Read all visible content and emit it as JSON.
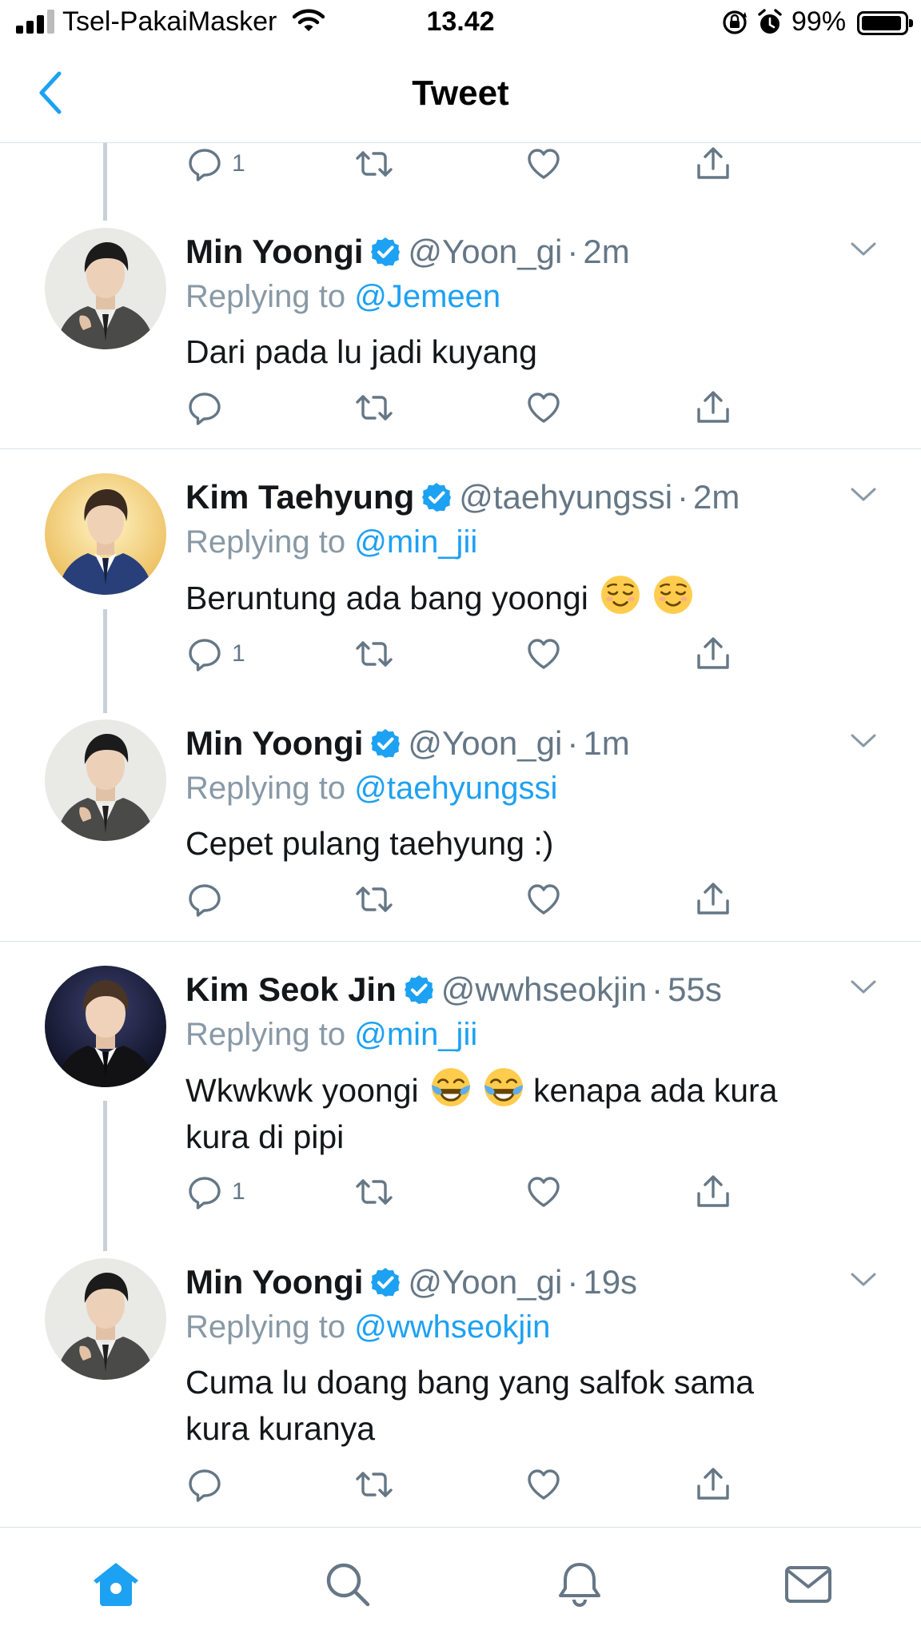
{
  "status_bar": {
    "carrier": "Tsel-PakaiMasker",
    "time": "13.42",
    "battery": "99%",
    "battery_level": 0.99
  },
  "nav": {
    "title": "Tweet",
    "back_icon": "chevron-left-icon"
  },
  "top_actions": {
    "reply_count": "1"
  },
  "tweets": [
    {
      "name": "Min Yoongi",
      "verified": true,
      "handle": "@Yoon_gi",
      "dot": "·",
      "time": "2m",
      "replying_label": "Replying to",
      "replying_to": "@Jemeen",
      "text": "Dari pada lu jadi kuyang",
      "reply_count": ""
    },
    {
      "name": "Kim Taehyung",
      "verified": true,
      "handle": "@taehyungssi",
      "dot": "·",
      "time": "2m",
      "replying_label": "Replying to",
      "replying_to": "@min_jii",
      "text": "Beruntung ada bang yoongi",
      "emojis": [
        "relieved-face-emoji",
        "relieved-face-emoji"
      ],
      "reply_count": "1"
    },
    {
      "name": "Min Yoongi",
      "verified": true,
      "handle": "@Yoon_gi",
      "dot": "·",
      "time": "1m",
      "replying_label": "Replying to",
      "replying_to": "@taehyungssi",
      "text": "Cepet pulang taehyung :)",
      "reply_count": ""
    },
    {
      "name": "Kim Seok Jin",
      "verified": true,
      "handle": "@wwhseokjin",
      "dot": "·",
      "time": "55s",
      "replying_label": "Replying to",
      "replying_to": "@min_jii",
      "text_before": "Wkwkwk yoongi",
      "emojis": [
        "tears-of-joy-emoji",
        "tears-of-joy-emoji"
      ],
      "text_after": "kenapa ada kura",
      "text_line2": "kura di pipi",
      "reply_count": "1"
    },
    {
      "name": "Min Yoongi",
      "verified": true,
      "handle": "@Yoon_gi",
      "dot": "·",
      "time": "19s",
      "replying_label": "Replying to",
      "replying_to": "@wwhseokjin",
      "text_line1": "Cuma lu doang bang yang salfok sama",
      "text_line2": "kura kuranya",
      "reply_count": ""
    }
  ],
  "tab_bar": {
    "tabs": [
      "home-icon",
      "search-icon",
      "notifications-bell-icon",
      "messages-mail-icon"
    ],
    "active": "home-icon"
  },
  "colors": {
    "accent": "#1da1f2",
    "text": "#14171a",
    "muted": "#657786",
    "icon_gray": "#657786",
    "divider": "#dbe2e8"
  }
}
